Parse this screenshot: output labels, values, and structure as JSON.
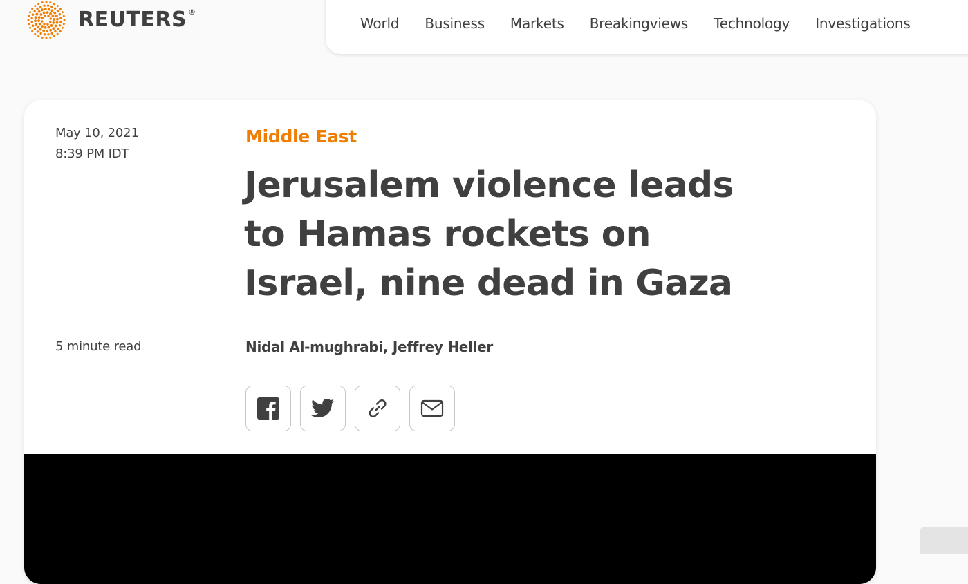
{
  "brand": {
    "name": "REUTERS",
    "registered_mark": "®",
    "accent_color": "#f07c00"
  },
  "nav": {
    "items": [
      {
        "label": "World"
      },
      {
        "label": "Business"
      },
      {
        "label": "Markets"
      },
      {
        "label": "Breakingviews"
      },
      {
        "label": "Technology"
      },
      {
        "label": "Investigations"
      }
    ]
  },
  "article": {
    "date": "May 10, 2021",
    "time": "8:39 PM IDT",
    "read_time": "5 minute read",
    "section": "Middle East",
    "headline": "Jerusalem violence leads to Hamas rockets on Israel, nine dead in Gaza",
    "byline": "Nidal Al-mughrabi, Jeffrey Heller"
  },
  "share": {
    "buttons": [
      {
        "icon": "facebook-icon"
      },
      {
        "icon": "twitter-icon"
      },
      {
        "icon": "link-icon"
      },
      {
        "icon": "email-icon"
      }
    ]
  }
}
